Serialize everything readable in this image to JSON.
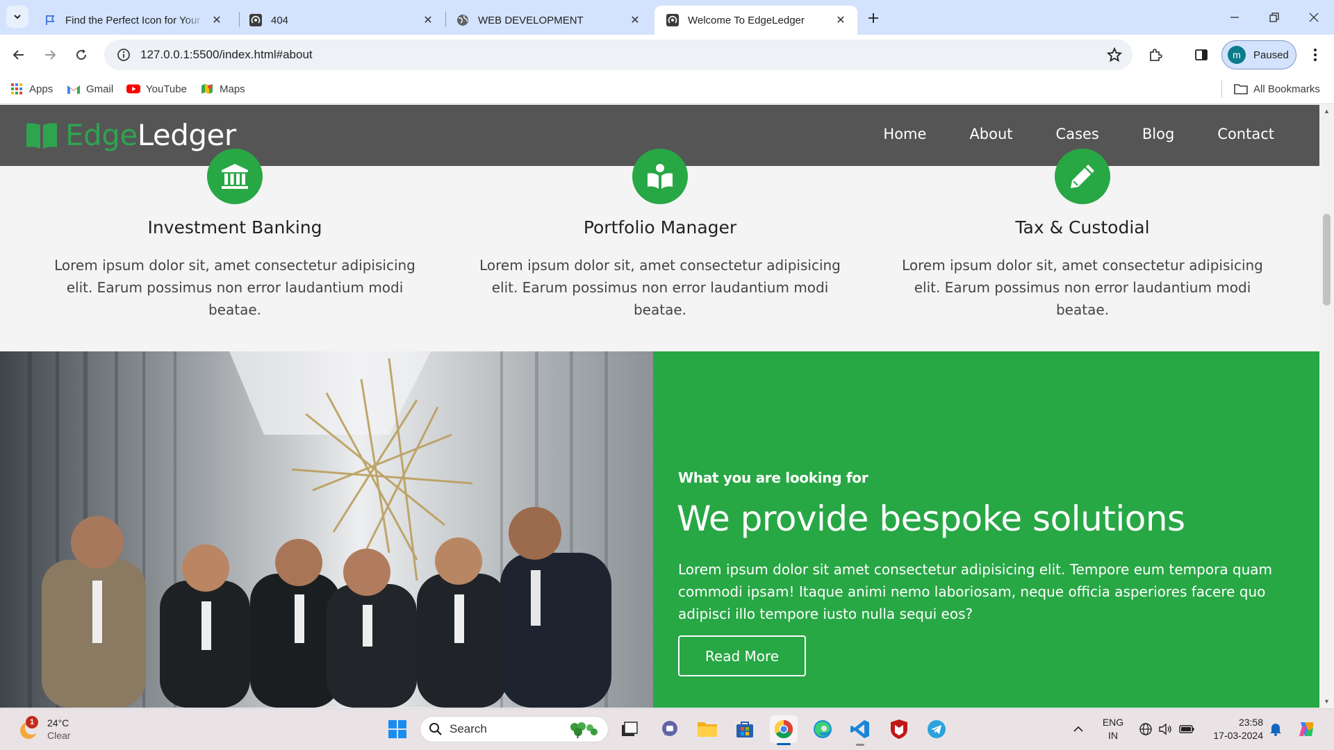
{
  "browser": {
    "tabs": [
      {
        "title": "Find the Perfect Icon for Your Pr",
        "icon": "flag-icon",
        "active": false
      },
      {
        "title": "404",
        "icon": "podcast-icon",
        "active": false
      },
      {
        "title": "WEB DEVELOPMENT",
        "icon": "globe-icon",
        "active": false
      },
      {
        "title": "Welcome To EdgeLedger",
        "icon": "podcast-icon",
        "active": true
      }
    ],
    "url": "127.0.0.1:5500/index.html#about",
    "profile_initial": "m",
    "profile_status": "Paused",
    "bookmarks": [
      {
        "label": "Apps",
        "icon": "apps-grid-icon"
      },
      {
        "label": "Gmail",
        "icon": "gmail-icon"
      },
      {
        "label": "YouTube",
        "icon": "youtube-icon"
      },
      {
        "label": "Maps",
        "icon": "maps-icon"
      }
    ],
    "all_bookmarks": "All Bookmarks"
  },
  "site": {
    "logo_part1": "Edge",
    "logo_part2": "Ledger",
    "nav": [
      "Home",
      "About",
      "Cases",
      "Blog",
      "Contact"
    ],
    "services": [
      {
        "title": "Investment Banking",
        "icon": "bank-icon",
        "text": "Lorem ipsum dolor sit, amet consectetur adipisicing elit. Earum possimus non error laudantium modi beatae."
      },
      {
        "title": "Portfolio Manager",
        "icon": "book-reader-icon",
        "text": "Lorem ipsum dolor sit, amet consectetur adipisicing elit. Earum possimus non error laudantium modi beatae."
      },
      {
        "title": "Tax & Custodial",
        "icon": "pencil-icon",
        "text": "Lorem ipsum dolor sit, amet consectetur adipisicing elit. Earum possimus non error laudantium modi beatae."
      }
    ],
    "about": {
      "kicker": "What you are looking for",
      "heading": "We provide bespoke solutions",
      "text": "Lorem ipsum dolor sit amet consectetur adipisicing elit. Tempore eum tempora quam commodi ipsam! Itaque animi nemo laboriosam, neque officia asperiores facere quo adipisci illo tempore iusto nulla sequi eos?",
      "button": "Read More"
    }
  },
  "taskbar": {
    "weather_temp": "24°C",
    "weather_cond": "Clear",
    "weather_badge": "1",
    "search_label": "Search",
    "lang_line1": "ENG",
    "lang_line2": "IN",
    "time": "23:58",
    "date": "17-03-2024"
  },
  "colors": {
    "brand_green": "#28a745",
    "header_gray": "#555555",
    "tab_bar": "#d3e3fd"
  }
}
